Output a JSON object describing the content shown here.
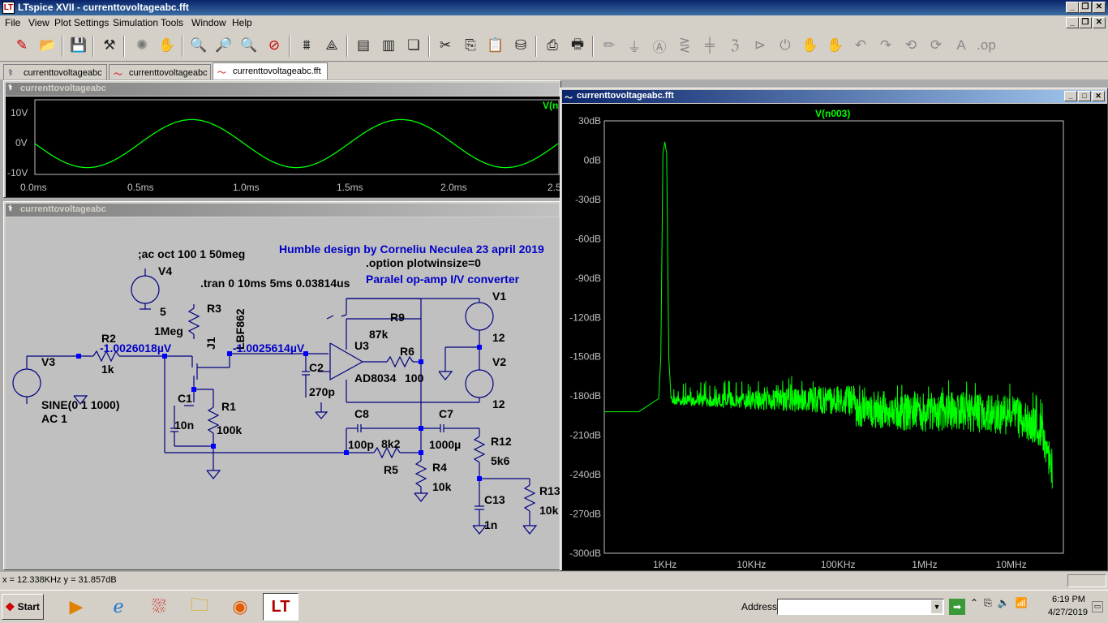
{
  "app": {
    "title": "LTspice XVII - currenttovoltageabc.fft"
  },
  "menu": [
    "File",
    "View",
    "Plot Settings",
    "Simulation",
    "Tools",
    "Window",
    "Help"
  ],
  "tabs": [
    {
      "label": "currenttovoltageabc",
      "icon": "schematic-icon"
    },
    {
      "label": "currenttovoltageabc",
      "icon": "waveform-icon"
    },
    {
      "label": "currenttovoltageabc.fft",
      "icon": "waveform-icon"
    }
  ],
  "waveform": {
    "title": "currenttovoltageabc",
    "trace": "V(n",
    "yticks": [
      "10V",
      "0V",
      "-10V"
    ],
    "xticks": [
      "0.0ms",
      "0.5ms",
      "1.0ms",
      "1.5ms",
      "2.0ms",
      "2.5"
    ]
  },
  "schematic": {
    "title": "currenttovoltageabc",
    "texts": {
      "heading": "Humble design by Corneliu Neculea 23 april 2019",
      "option": ".option plotwinsize=0",
      "subtitle": "Paralel op-amp I/V converter",
      "ac": ";ac oct 100 1 50meg",
      "tran": ".tran 0 10ms 5ms 0.03814us",
      "v4": "V4",
      "v4val": "5",
      "r3": "R3",
      "r3val": "1Meg",
      "jfet": "J1",
      "jfetmodel": "LBF862",
      "r2": "R2",
      "r2val": "1k",
      "v3": "V3",
      "v3sine": "SINE(0 1 1000)",
      "v3ac": "AC 1",
      "probe1": "-1.0026018µV",
      "probe2": "-1.0025614µV",
      "c1": "C1",
      "c1val": "10n",
      "r1": "R1",
      "r1val": "100k",
      "c2": "C2",
      "c2val": "270p",
      "u3": "U3",
      "u3model": "AD8034",
      "r9": "R9",
      "r9val": "87k",
      "r6": "R6",
      "r6val": "100",
      "v1": "V1",
      "v1val": "12",
      "v2": "V2",
      "v2val": "12",
      "c8": "C8",
      "c8val": "100p",
      "r5": "R5",
      "r5val": "8k2",
      "c7": "C7",
      "c7val": "1000µ",
      "r4": "R4",
      "r4val": "10k",
      "r12": "R12",
      "r12val": "5k6",
      "c13": "C13",
      "c13val": "1n",
      "r13": "R13",
      "r13val": "10k"
    }
  },
  "fft": {
    "title": "currenttovoltageabc.fft",
    "trace": "V(n003)",
    "yticks": [
      "30dB",
      "0dB",
      "-30dB",
      "-60dB",
      "-90dB",
      "-120dB",
      "-150dB",
      "-180dB",
      "-210dB",
      "-240dB",
      "-270dB",
      "-300dB"
    ],
    "xticks": [
      "1KHz",
      "10KHz",
      "100KHz",
      "1MHz",
      "10MHz"
    ]
  },
  "status": {
    "cursor_text": "x = 12.338KHz    y = 31.857dB"
  },
  "taskbar": {
    "start": "Start",
    "address_label": "Address",
    "time": "6:19 PM",
    "date": "4/27/2019"
  },
  "colors": {
    "trace": "#00ff00",
    "schematic_bg": "#c0c0c0",
    "wire": "#000080",
    "label_blue": "#0000c8"
  }
}
